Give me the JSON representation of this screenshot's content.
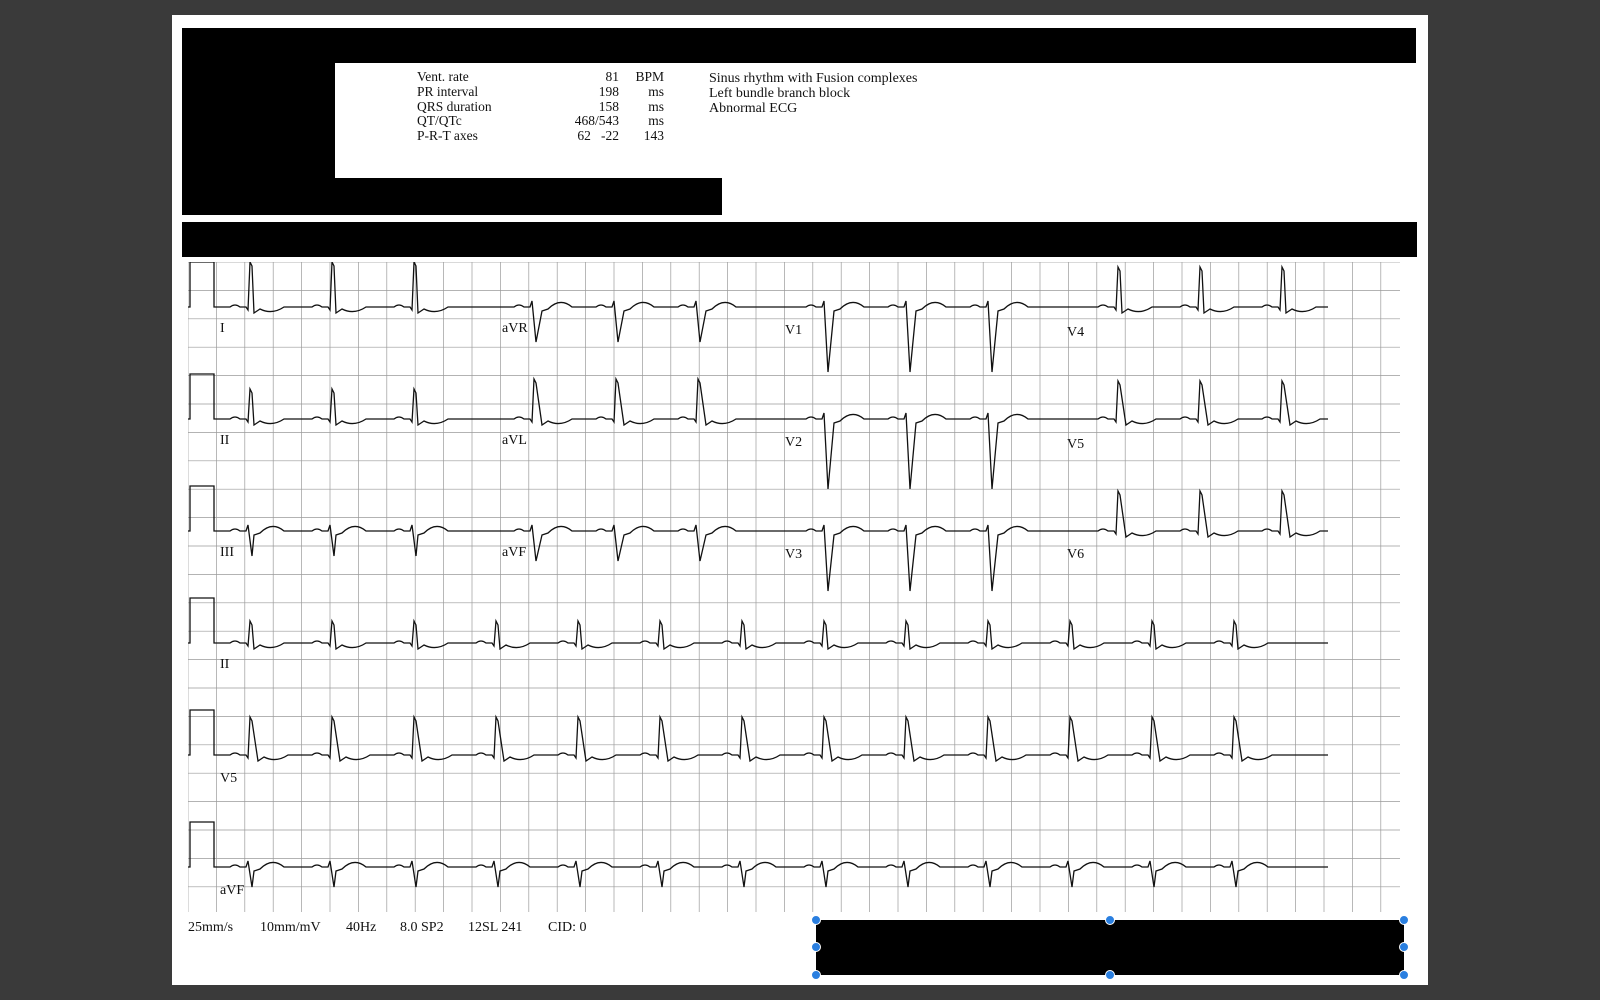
{
  "measurements": [
    {
      "label": "Vent. rate",
      "value": "81",
      "unit": "BPM"
    },
    {
      "label": "PR interval",
      "value": "198",
      "unit": "ms"
    },
    {
      "label": "QRS duration",
      "value": "158",
      "unit": "ms"
    },
    {
      "label": "QT/QTc",
      "value": "468/543",
      "unit": "ms"
    },
    {
      "label": "P-R-T axes",
      "value": "62   -22",
      "unit": "143"
    }
  ],
  "interpretation": [
    "Sinus rhythm with Fusion complexes",
    "Left bundle branch block",
    "Abnormal ECG"
  ],
  "leads": {
    "row1": [
      "I",
      "aVR",
      "V1",
      "V4"
    ],
    "row2": [
      "II",
      "aVL",
      "V2",
      "V5"
    ],
    "row3": [
      "III",
      "aVF",
      "V3",
      "V6"
    ],
    "rhythm": [
      "II",
      "V5",
      "aVF"
    ]
  },
  "footer": {
    "speed": "25mm/s",
    "gain": "10mm/mV",
    "filter": "40Hz",
    "version": "8.0 SP2",
    "program": "12SL 241",
    "cid": "CID: 0"
  },
  "colors": {
    "background": "#3a3a3a",
    "paper": "#ffffff",
    "grid": "#9a9a9a",
    "trace": "#111111",
    "selection_handle": "#2a7fe0",
    "redaction": "#000000"
  }
}
